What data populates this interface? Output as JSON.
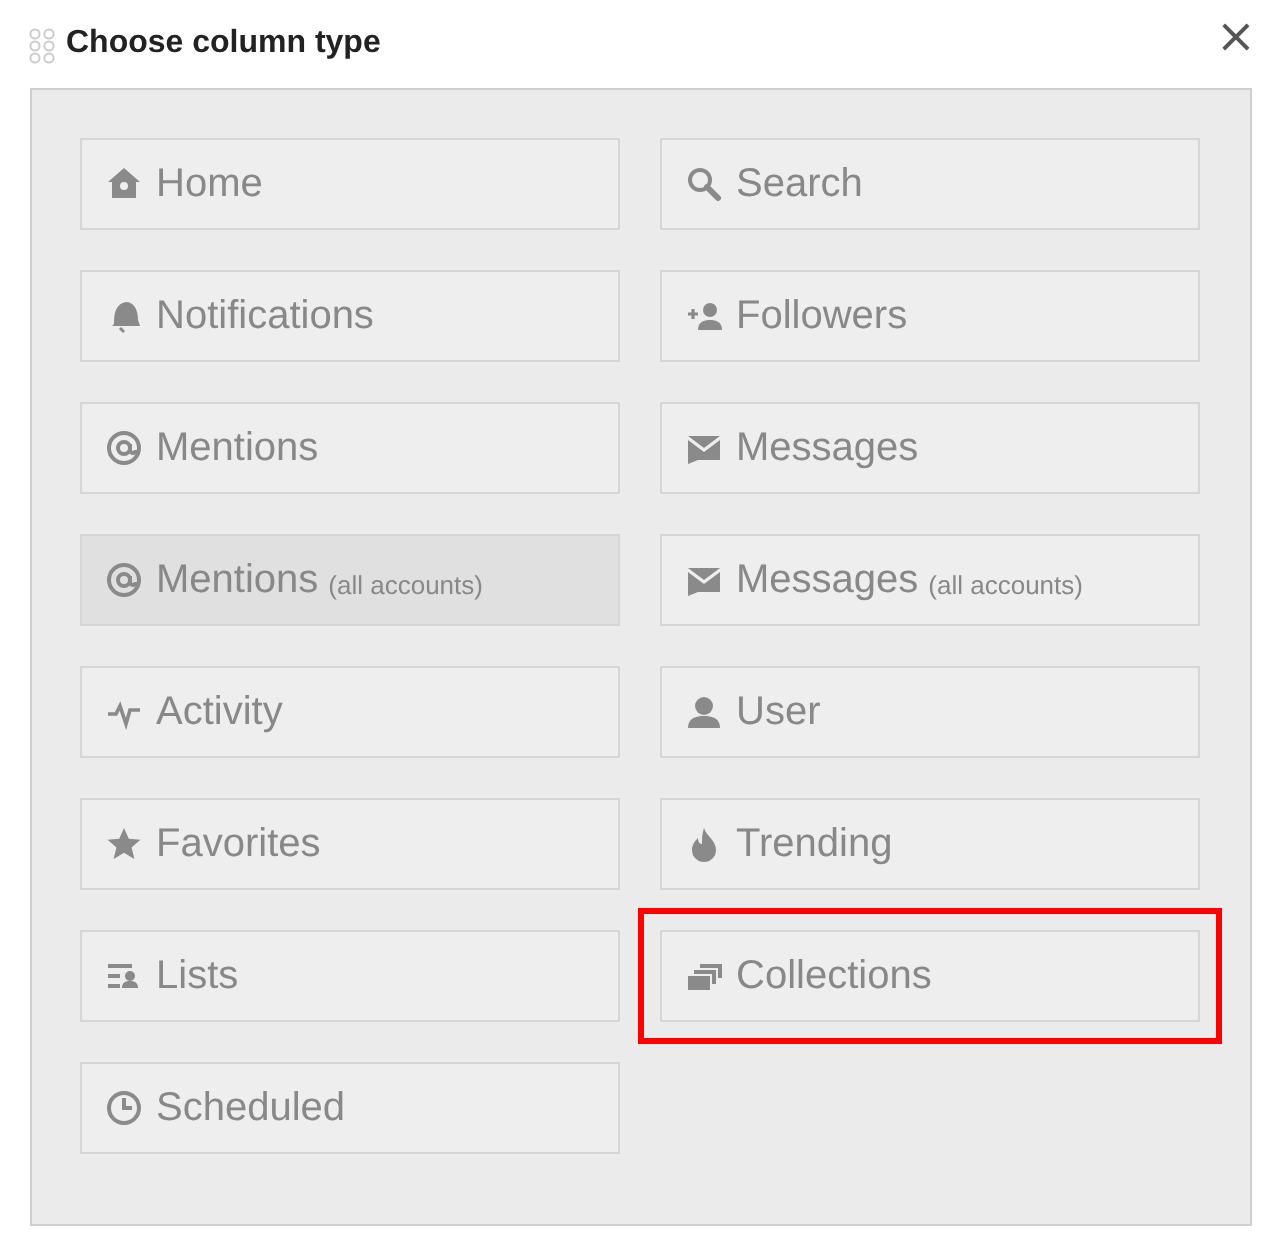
{
  "dialog": {
    "title": "Choose column type",
    "close": "×"
  },
  "options": [
    {
      "kind": "home",
      "label": "Home",
      "selected": false,
      "highlighted": false
    },
    {
      "kind": "search",
      "label": "Search",
      "selected": false,
      "highlighted": false
    },
    {
      "kind": "bell",
      "label": "Notifications",
      "selected": false,
      "highlighted": false
    },
    {
      "kind": "follow",
      "label": "Followers",
      "selected": false,
      "highlighted": false
    },
    {
      "kind": "at",
      "label": "Mentions",
      "selected": false,
      "highlighted": false
    },
    {
      "kind": "mail",
      "label": "Messages",
      "selected": false,
      "highlighted": false
    },
    {
      "kind": "at",
      "label": "Mentions",
      "note": "(all accounts)",
      "selected": true,
      "highlighted": false
    },
    {
      "kind": "mail",
      "label": "Messages",
      "note": "(all accounts)",
      "selected": false,
      "highlighted": false
    },
    {
      "kind": "activity",
      "label": "Activity",
      "selected": false,
      "highlighted": false
    },
    {
      "kind": "user",
      "label": "User",
      "selected": false,
      "highlighted": false
    },
    {
      "kind": "star",
      "label": "Favorites",
      "selected": false,
      "highlighted": false
    },
    {
      "kind": "flame",
      "label": "Trending",
      "selected": false,
      "highlighted": false
    },
    {
      "kind": "lists",
      "label": "Lists",
      "selected": false,
      "highlighted": false
    },
    {
      "kind": "collections",
      "label": "Collections",
      "selected": false,
      "highlighted": true
    },
    {
      "kind": "clock",
      "label": "Scheduled",
      "selected": false,
      "highlighted": false
    }
  ]
}
